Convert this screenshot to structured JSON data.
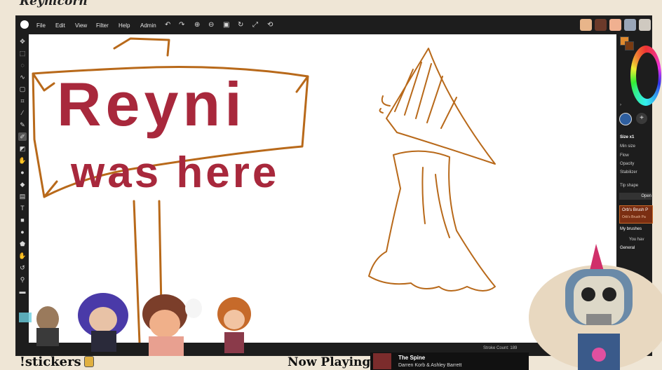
{
  "frame": {
    "title": "Reynicorn"
  },
  "menubar": {
    "items": [
      "File",
      "Edit",
      "View",
      "Filter",
      "Help",
      "Admin"
    ],
    "tool_icons": [
      "undo-icon",
      "redo-icon",
      "zoom-in-icon",
      "zoom-out-icon",
      "fit-icon",
      "rotate-icon",
      "fullscreen-icon",
      "reset-icon"
    ]
  },
  "right_panel": {
    "size_label": "Size x1",
    "min_size_label": "Min size",
    "flow_label": "Flow",
    "opacity_label": "Opacity",
    "stabilizer_label": "Stabilizer",
    "tip_shape_label": "Tip shape",
    "open_button": "Open",
    "brush_title": "Orb's Brush P",
    "brush_subtitle": "Orb's Brush Pa",
    "my_brushes_label": "My brushes",
    "you_have_label": "You hav",
    "general_label": "General"
  },
  "status": {
    "stroke_count": "Stroke Count: 189"
  },
  "canvas": {
    "sign_line1": "Reyni",
    "sign_line2": "was here"
  },
  "stream": {
    "stickers_label": "!stickers",
    "now_playing_label": "Now Playing",
    "song_title": "The Spine",
    "song_artist": "Darren Korb & Ashley Barrett"
  },
  "colors": {
    "sign_text": "#a8283c",
    "sketch": "#b8691a",
    "ui_dark": "#1d1d1d",
    "frame": "#efe6d6"
  }
}
